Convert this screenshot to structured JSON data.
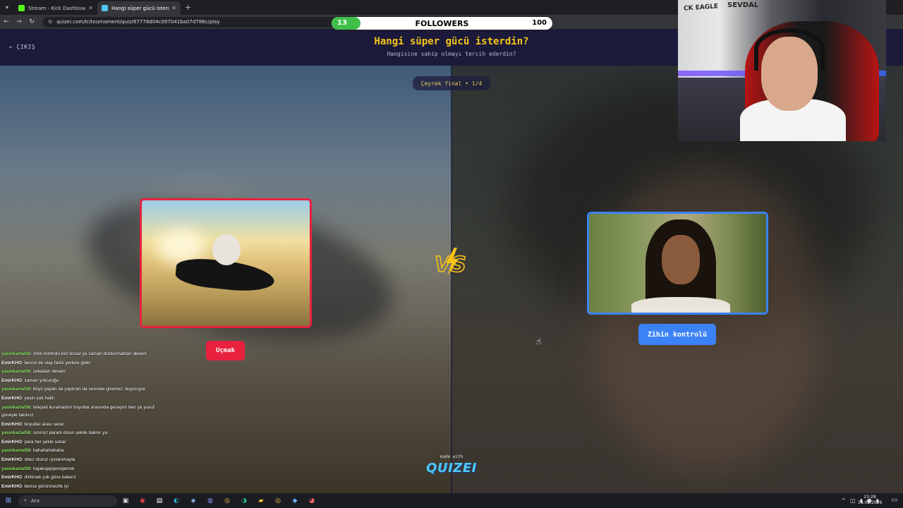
{
  "browser": {
    "tabs": [
      {
        "label": "Stream - Kick Dashboard",
        "favicon_color": "#53fc18",
        "active": false
      },
      {
        "label": "Hangi süper gücü isterdin? - Tu",
        "favicon_color": "#4ec8f4",
        "active": true
      }
    ],
    "url": "quizei.com/tr/tournament/quiz/67778d04c097041ba07d786c/play"
  },
  "quiz": {
    "exit_label": "ÇIKIŞ",
    "title": "Hangi süper gücü isterdin?",
    "subtitle": "Hangisine sahip olmayı tercih ederdin?",
    "round": "Çeyrek final • 1/4",
    "left_option": {
      "label": "Uçmak",
      "color": "#e8213e"
    },
    "right_option": {
      "label": "Zihin kontrolü",
      "color": "#3b82f6"
    },
    "made_with": "made with",
    "brand": "QUIZEI"
  },
  "followers_goal": {
    "current": "13",
    "label": "FOLLOWERS",
    "goal": "100",
    "progress_fraction": 0.13,
    "fill_color": "#3fbf4a"
  },
  "chat": [
    {
      "user": "yasinkartal58",
      "text": ": zihin kontrolü bizi bozar ya zaman durdurmaktan devam",
      "color": "green"
    },
    {
      "user": "EmirKHO",
      "text": ": bence de olay farklı yerlere gider",
      "color": "white"
    },
    {
      "user": "yasinkartal58",
      "text": ": zekadan devam",
      "color": "green"
    },
    {
      "user": "EmirKHO",
      "text": ": zaman yolculuğu",
      "color": "white"
    },
    {
      "user": "yasinkartal58",
      "text": ": büyü yapan da yaptıran da cennete giremez. buyuruyor",
      "color": "green"
    },
    {
      "user": "EmirKHO",
      "text": ": yasin çok haklı",
      "color": "white"
    },
    {
      "user": "yasinkartal58",
      "text": ": telepati kuramadım boyutlar arasında gezeyim ben ya yusuf güneyle takılırız",
      "color": "green",
      "wrap": true
    },
    {
      "user": "EmirKHO",
      "text": ": boyutlar arası sarar",
      "color": "white"
    },
    {
      "user": "yasinkartal58",
      "text": ": sınırsız param olsun şekile bakılır ya",
      "color": "green"
    },
    {
      "user": "EmirKHO",
      "text": ": para her şekle sokar",
      "color": "white"
    },
    {
      "user": "yasinkartal58",
      "text": ": hahahahahaha",
      "color": "green"
    },
    {
      "user": "EmirKHO",
      "text": ": obez oluruz ışınlanmayla",
      "color": "white"
    },
    {
      "user": "yasinkartal58",
      "text": ": hajakxjajsjwnxjamxk",
      "color": "green"
    },
    {
      "user": "EmirKHO",
      "text": ": dirilirsek çok göze batarız",
      "color": "white"
    },
    {
      "user": "EmirKHO",
      "text": ": bence görünmezlik iyi",
      "color": "white"
    }
  ],
  "webcam": {
    "banner_left": "CK EAGLE",
    "banner_right": "SEVDAL"
  },
  "taskbar": {
    "search_placeholder": "Ara",
    "time": "23:28",
    "date": "18.02.2026"
  }
}
